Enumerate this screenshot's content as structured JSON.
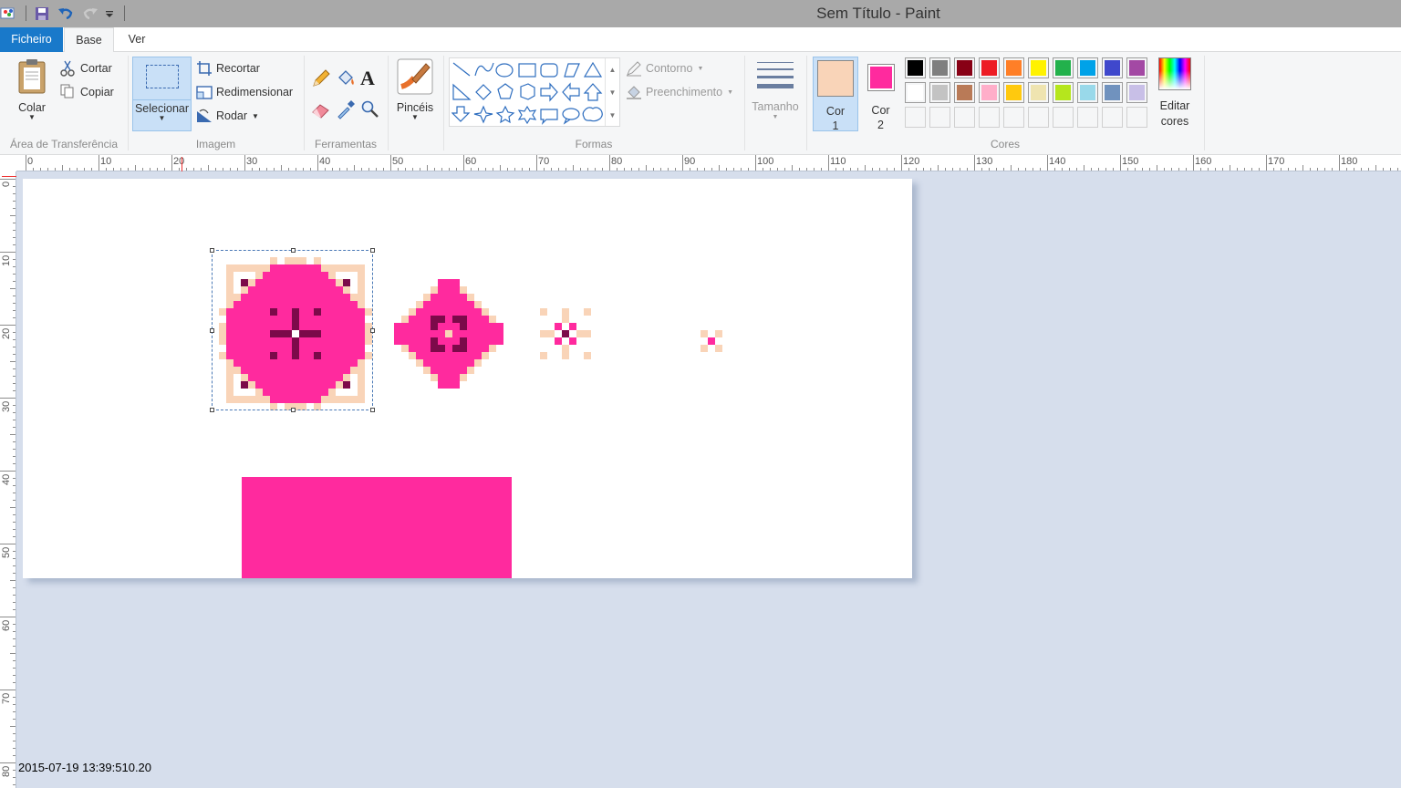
{
  "window": {
    "title": "Sem Título - Paint"
  },
  "tabs": {
    "file": "Ficheiro",
    "home": "Base",
    "view": "Ver"
  },
  "clipboard": {
    "paste": "Colar",
    "cut": "Cortar",
    "copy": "Copiar",
    "label": "Área de Transferência"
  },
  "image": {
    "select": "Selecionar",
    "crop": "Recortar",
    "resize": "Redimensionar",
    "rotate": "Rodar",
    "label": "Imagem"
  },
  "tools": {
    "label": "Ferramentas"
  },
  "brushes": {
    "label": "Pincéis"
  },
  "shapes": {
    "outline": "Contorno",
    "fill": "Preenchimento",
    "label": "Formas"
  },
  "size": {
    "label": "Tamanho"
  },
  "colors": {
    "color1_label": "Cor\n1",
    "color1_line1": "Cor",
    "color1_line2": "1",
    "color2_line1": "Cor",
    "color2_line2": "2",
    "color1": "#f9d4b8",
    "color2": "#ff2a9e",
    "edit_line1": "Editar",
    "edit_line2": "cores",
    "label": "Cores",
    "palette_row1": [
      "#000000",
      "#7f7f7f",
      "#880015",
      "#ed1c24",
      "#ff7f27",
      "#fff200",
      "#22b14c",
      "#00a2e8",
      "#3f48cc",
      "#a349a4"
    ],
    "palette_row2": [
      "#ffffff",
      "#c3c3c3",
      "#b97a57",
      "#ffaec9",
      "#ffc90e",
      "#efe4b0",
      "#b5e61d",
      "#99d9ea",
      "#7092be",
      "#c8bfe7"
    ]
  },
  "ruler": {
    "h_labels": [
      "0",
      "10",
      "20",
      "30",
      "40",
      "50",
      "60",
      "70",
      "80",
      "90",
      "100",
      "110",
      "120",
      "130",
      "140",
      "150",
      "160",
      "170",
      "180"
    ],
    "v_labels": [
      "0",
      "10",
      "20",
      "30",
      "40",
      "50",
      "60",
      "70",
      "80"
    ]
  },
  "status": {
    "timestamp": "2015-07-19 13:39:510.20"
  }
}
